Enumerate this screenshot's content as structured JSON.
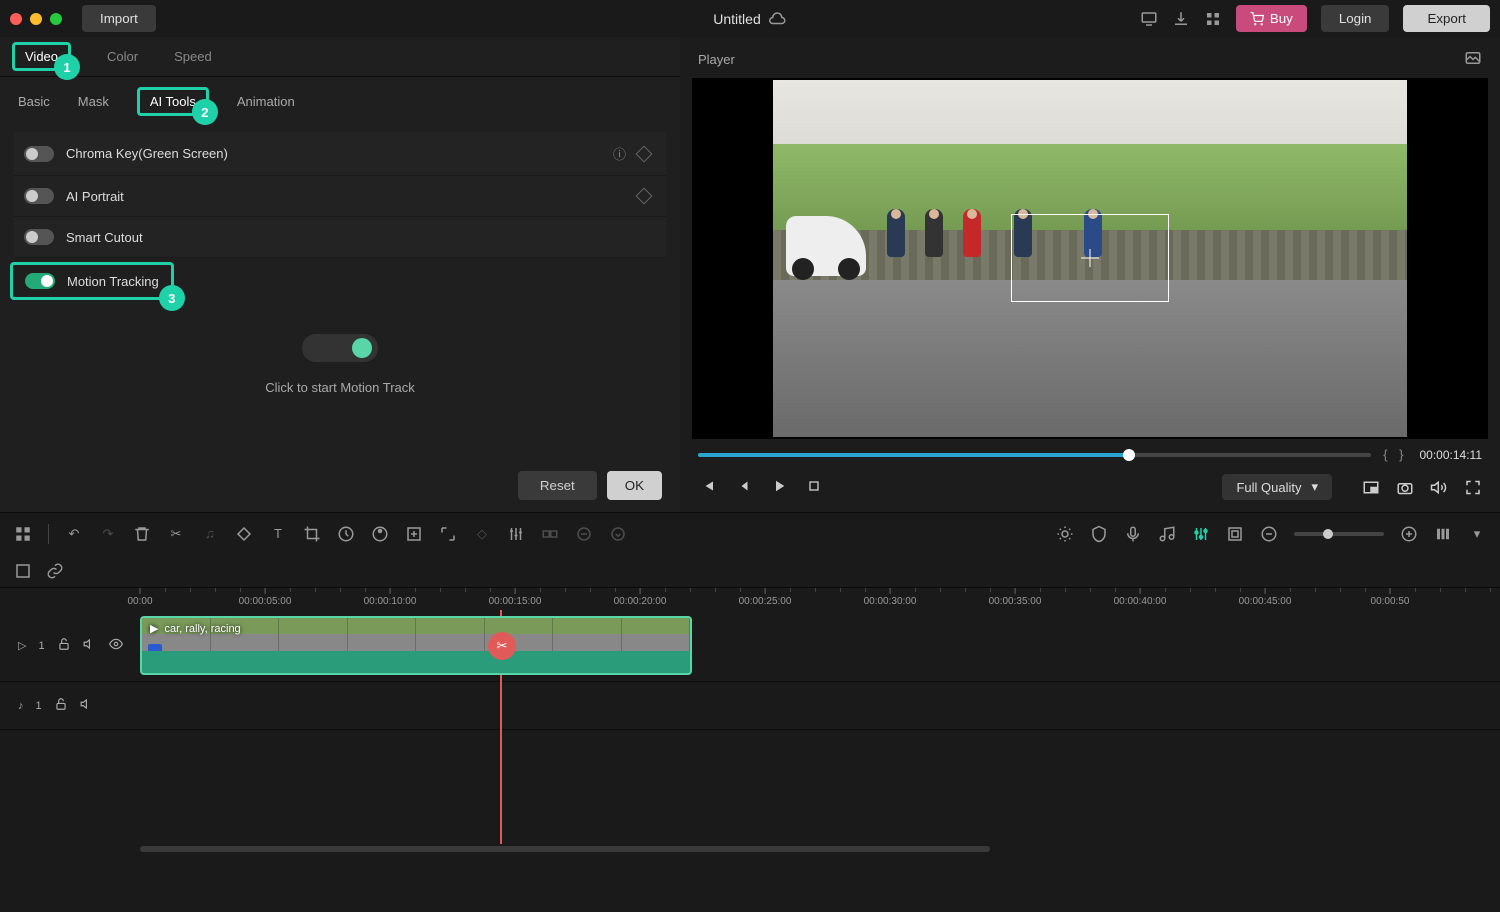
{
  "topbar": {
    "import": "Import",
    "title": "Untitled",
    "buy": "Buy",
    "login": "Login",
    "export": "Export"
  },
  "prop_tabs": {
    "video": "Video",
    "color": "Color",
    "speed": "Speed"
  },
  "sub_tabs": {
    "basic": "Basic",
    "mask": "Mask",
    "aitools": "AI Tools",
    "animation": "Animation"
  },
  "badges": {
    "b1": "1",
    "b2": "2",
    "b3": "3"
  },
  "tools": {
    "chroma": "Chroma Key(Green Screen)",
    "portrait": "AI Portrait",
    "cutout": "Smart Cutout",
    "motion": "Motion Tracking"
  },
  "motion_hint": "Click to start Motion Track",
  "footer": {
    "reset": "Reset",
    "ok": "OK"
  },
  "player": {
    "label": "Player",
    "time": "00:00:14:11",
    "quality": "Full Quality",
    "brackets": "{    }"
  },
  "ruler": [
    "00:00",
    "00:00:05:00",
    "00:00:10:00",
    "00:00:15:00",
    "00:00:20:00",
    "00:00:25:00",
    "00:00:30:00",
    "00:00:35:00",
    "00:00:40:00",
    "00:00:45:00",
    "00:00:50"
  ],
  "clip": {
    "label": "car, rally, racing"
  },
  "track_heads": {
    "v1": "1",
    "a1": "1"
  }
}
